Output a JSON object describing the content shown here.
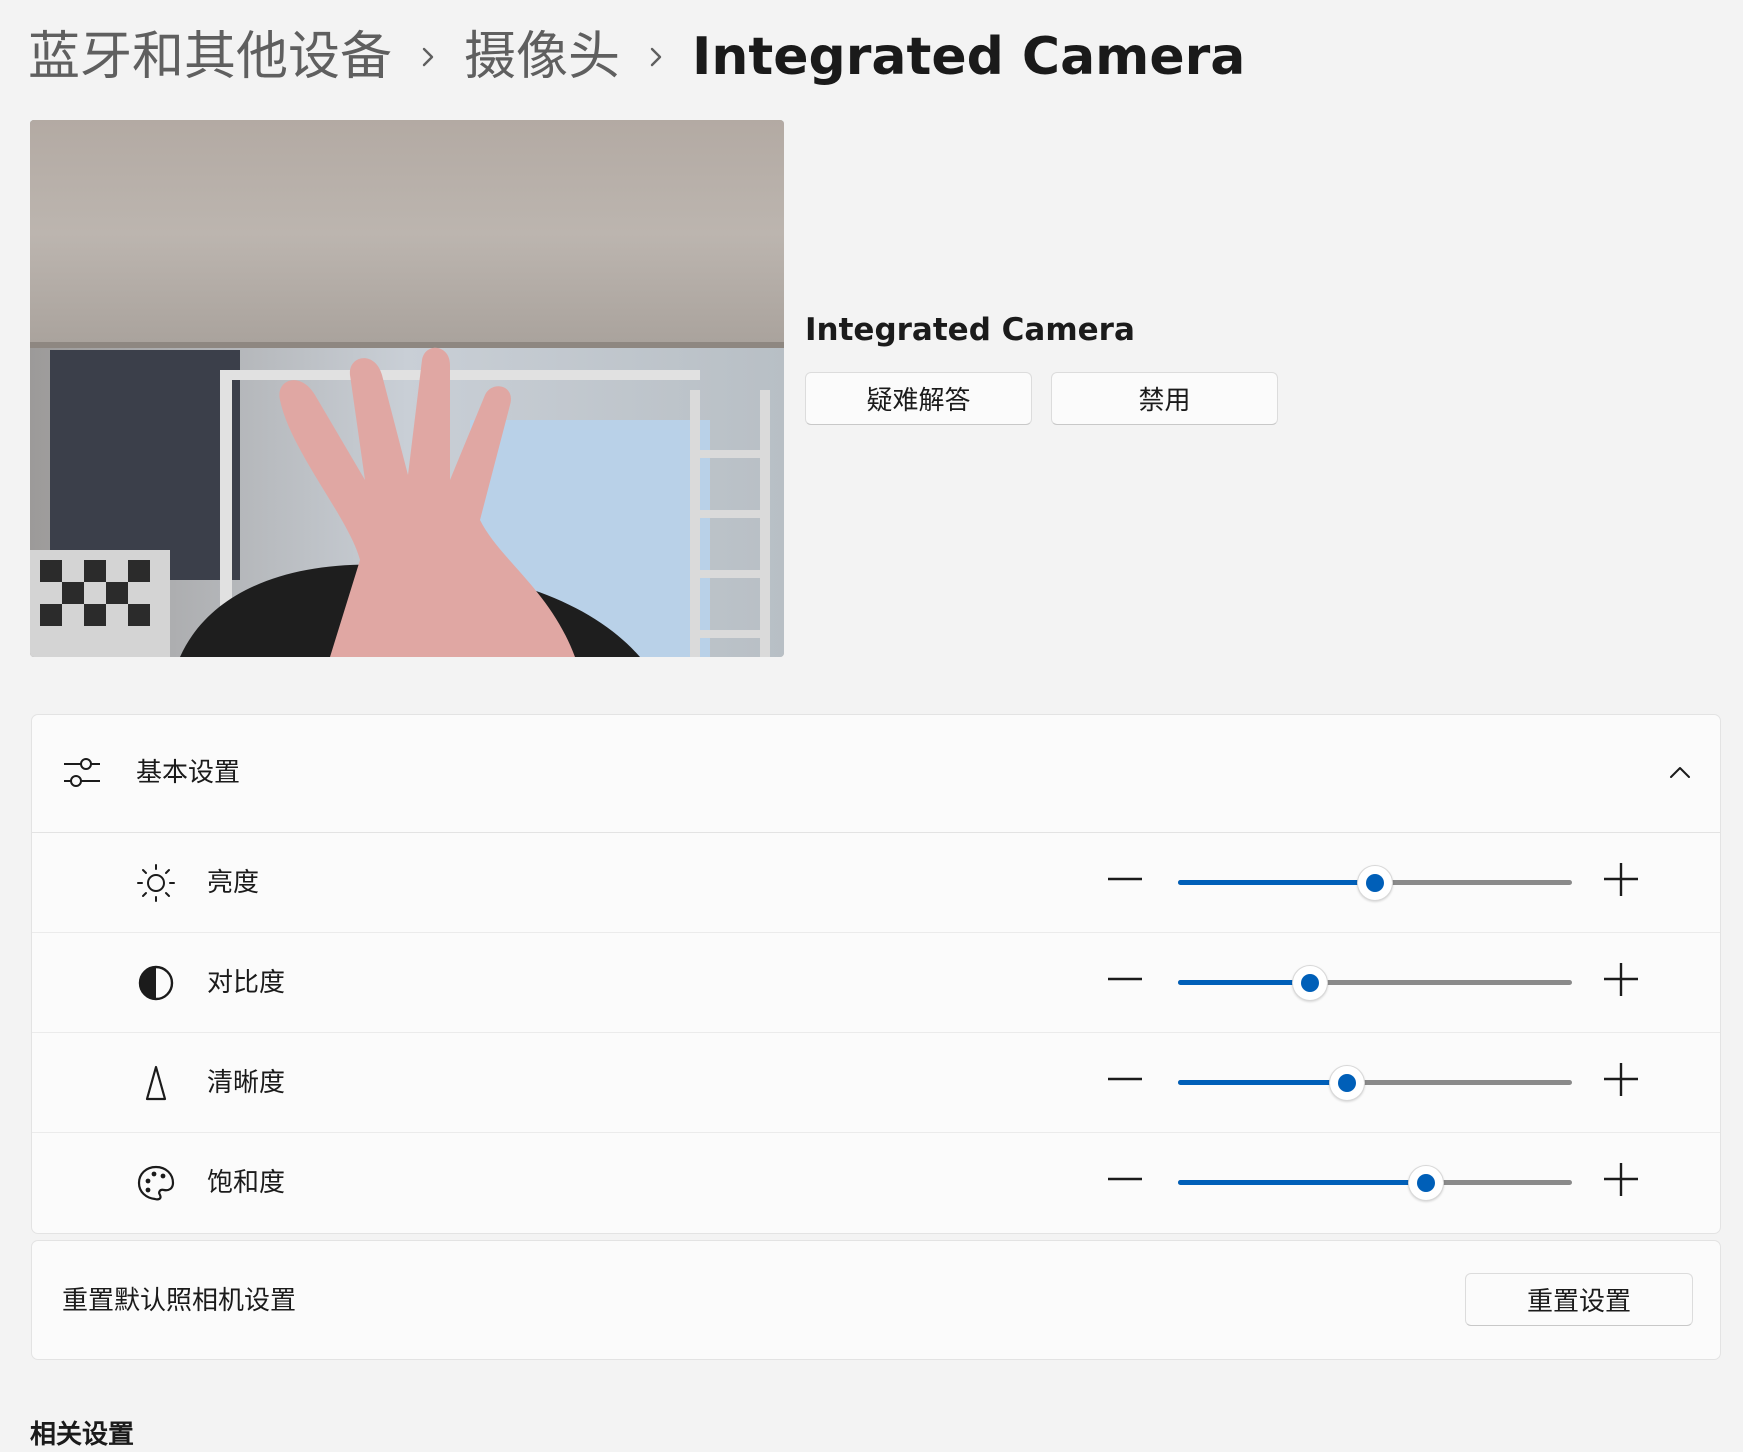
{
  "breadcrumb": {
    "items": [
      "蓝牙和其他设备",
      "摄像头",
      "Integrated Camera"
    ]
  },
  "device": {
    "name": "Integrated Camera",
    "troubleshoot_label": "疑难解答",
    "disable_label": "禁用"
  },
  "basic_settings": {
    "title": "基本设置",
    "expanded": true,
    "sliders": [
      {
        "label": "亮度",
        "icon": "sun-icon",
        "value": 0.5
      },
      {
        "label": "对比度",
        "icon": "contrast-icon",
        "value": 0.335
      },
      {
        "label": "清晰度",
        "icon": "sharpness-icon",
        "value": 0.43
      },
      {
        "label": "饱和度",
        "icon": "palette-icon",
        "value": 0.63
      }
    ]
  },
  "reset": {
    "label": "重置默认照相机设置",
    "button_label": "重置设置"
  },
  "related": {
    "title": "相关设置"
  },
  "colors": {
    "accent": "#005fb8",
    "page_bg": "#f3f3f3",
    "card_bg": "#fbfbfb"
  }
}
